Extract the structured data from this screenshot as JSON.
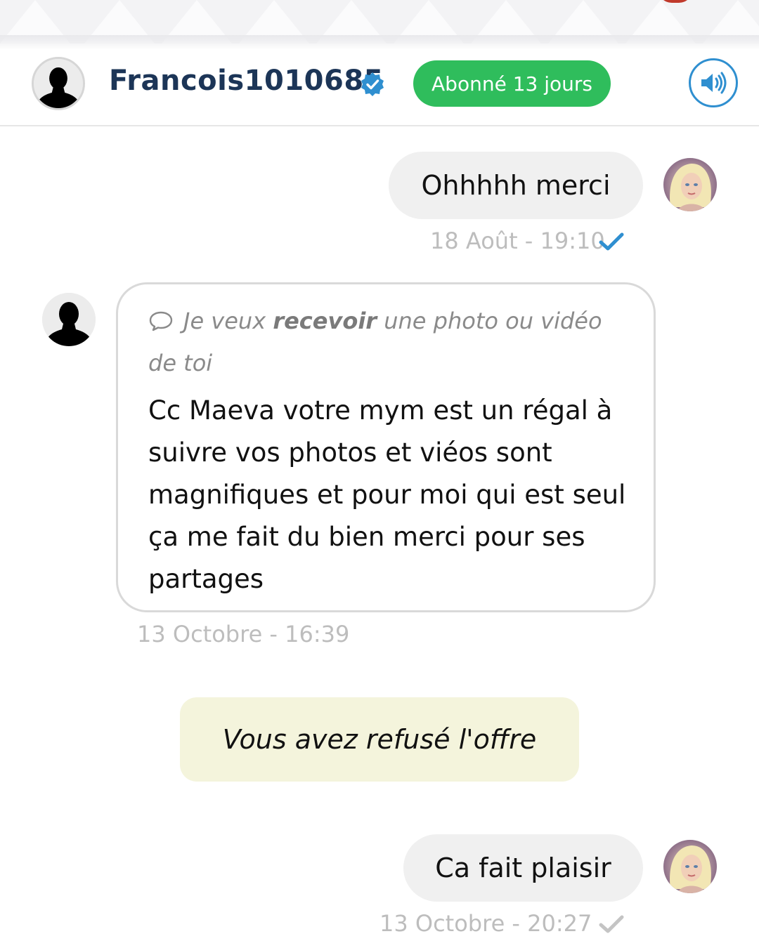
{
  "header": {
    "username": "Francois1010685",
    "subscription_badge": "Abonné 13 jours",
    "icons": {
      "avatar": "user-silhouette-icon",
      "verified": "verified-check-icon",
      "sound": "speaker-icon"
    },
    "colors": {
      "username": "#1c3557",
      "badge": "#2fbd5c",
      "verified": "#2f8fd0"
    }
  },
  "messages": [
    {
      "direction": "outgoing",
      "text": "Ohhhhh merci",
      "timestamp": "18 Août - 19:10",
      "status": "read",
      "status_color": "#2f8fd0"
    },
    {
      "direction": "incoming",
      "request_prefix": "Je veux ",
      "request_bold": "recevoir",
      "request_suffix": " une photo ou vidéo de toi",
      "text": "Cc Maeva votre mym est un régal à suivre vos photos et viéos sont magnifiques et pour moi qui est seul ça me fait du bien merci pour ses partages",
      "timestamp": "13 Octobre - 16:39"
    },
    {
      "direction": "system",
      "text": "Vous avez refusé l'offre",
      "background": "#f4f4dc"
    },
    {
      "direction": "outgoing",
      "text": "Ca fait plaisir",
      "timestamp": "13 Octobre - 20:27",
      "status": "sent",
      "status_color": "#c4c4c4"
    }
  ]
}
